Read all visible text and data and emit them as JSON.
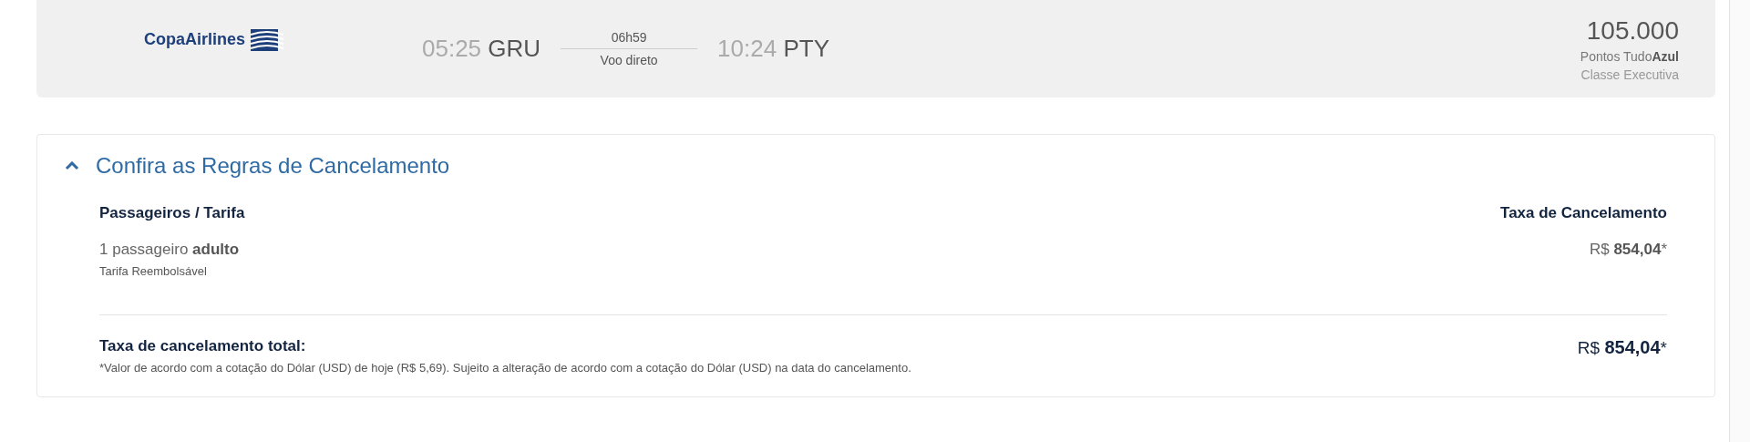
{
  "flight": {
    "airline": "CopaAirlines",
    "departure": {
      "time": "05:25",
      "airport": "GRU"
    },
    "duration": "06h59",
    "stops": "Voo direto",
    "arrival": {
      "time": "10:24",
      "airport": "PTY"
    },
    "points": "105.000",
    "points_label": "Pontos Tudo**Azul**",
    "cabin": "Classe Executiva"
  },
  "cancellation": {
    "title": "Confira as Regras de Cancelamento",
    "expanded": true,
    "columns": [
      "Passageiros / Tarifa",
      "Taxa de Cancelamento"
    ],
    "rows": [
      {
        "passengers": "1 passageiro **adulto**",
        "fare": "Tarifa Reembolsável",
        "fee": "R$ **854,04***"
      }
    ],
    "total": {
      "label": "Taxa de cancelamento total:",
      "note": "*Valor de acordo com a cotação do Dólar (USD) de hoje (R$ 5,69). Sujeito a alteração de acordo com a cotação do Dólar (USD) na data do cancelamento.",
      "fee": "R$ **854,04***"
    }
  }
}
